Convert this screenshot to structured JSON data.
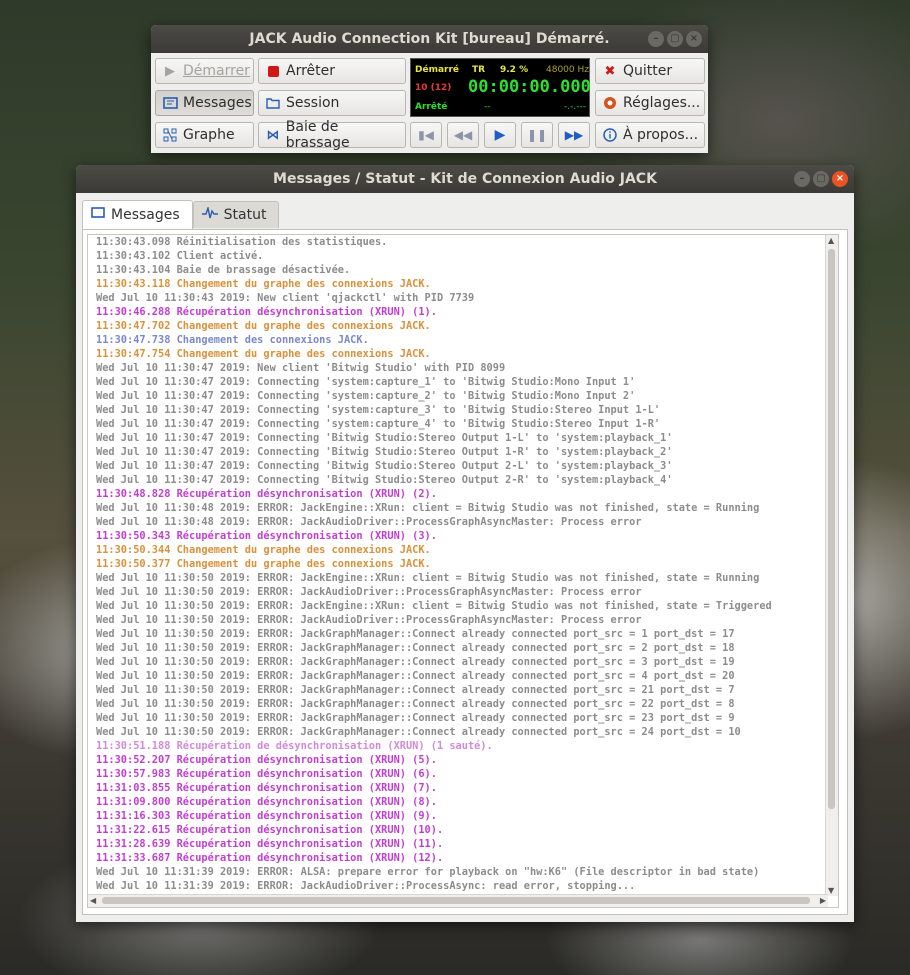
{
  "jack_window": {
    "title": "JACK Audio Connection Kit [bureau] Démarré.",
    "buttons": {
      "start": "Démarrer",
      "stop": "Arrêter",
      "quit": "Quitter",
      "messages": "Messages",
      "session": "Session",
      "settings": "Réglages...",
      "graph": "Graphe",
      "patchbay": "Baie de brassage",
      "about": "À propos..."
    },
    "display": {
      "state": "Démarré",
      "transport_mode": "TR",
      "dsp_load": "9.2 %",
      "sample_rate": "48000 Hz",
      "xruns": "10 (12)",
      "time": "00:00:00.000",
      "transport_state": "Arrêté",
      "bpm": "--",
      "bbt": "-.-.---"
    },
    "colors": {
      "display_green": "#2ee02e",
      "display_yellow": "#e6e63a",
      "display_red": "#e63a3a"
    }
  },
  "messages_window": {
    "title": "Messages / Statut - Kit de Connexion Audio JACK",
    "tabs": [
      {
        "label": "Messages",
        "icon": "monitor-icon",
        "active": true
      },
      {
        "label": "Statut",
        "icon": "waveform-icon",
        "active": false
      }
    ],
    "log_lines": [
      {
        "text": "11:30:43.098 Réinitialisation des statistiques.",
        "color": "gray"
      },
      {
        "text": "11:30:43.102 Client activé.",
        "color": "gray"
      },
      {
        "text": "11:30:43.104 Baie de brassage désactivée.",
        "color": "gray"
      },
      {
        "text": "11:30:43.118 Changement du graphe des connexions JACK.",
        "color": "orange"
      },
      {
        "text": "Wed Jul 10 11:30:43 2019: New client 'qjackctl' with PID 7739",
        "color": "gray"
      },
      {
        "text": "11:30:46.288 Récupération désynchronisation (XRUN) (1).",
        "color": "magenta"
      },
      {
        "text": "11:30:47.702 Changement du graphe des connexions JACK.",
        "color": "orange"
      },
      {
        "text": "11:30:47.738 Changement des connexions JACK.",
        "color": "blue"
      },
      {
        "text": "11:30:47.754 Changement du graphe des connexions JACK.",
        "color": "orange"
      },
      {
        "text": "Wed Jul 10 11:30:47 2019: New client 'Bitwig Studio' with PID 8099",
        "color": "gray"
      },
      {
        "text": "Wed Jul 10 11:30:47 2019: Connecting 'system:capture_1' to 'Bitwig Studio:Mono Input 1'",
        "color": "gray"
      },
      {
        "text": "Wed Jul 10 11:30:47 2019: Connecting 'system:capture_2' to 'Bitwig Studio:Mono Input 2'",
        "color": "gray"
      },
      {
        "text": "Wed Jul 10 11:30:47 2019: Connecting 'system:capture_3' to 'Bitwig Studio:Stereo Input 1-L'",
        "color": "gray"
      },
      {
        "text": "Wed Jul 10 11:30:47 2019: Connecting 'system:capture_4' to 'Bitwig Studio:Stereo Input 1-R'",
        "color": "gray"
      },
      {
        "text": "Wed Jul 10 11:30:47 2019: Connecting 'Bitwig Studio:Stereo Output 1-L' to 'system:playback_1'",
        "color": "gray"
      },
      {
        "text": "Wed Jul 10 11:30:47 2019: Connecting 'Bitwig Studio:Stereo Output 1-R' to 'system:playback_2'",
        "color": "gray"
      },
      {
        "text": "Wed Jul 10 11:30:47 2019: Connecting 'Bitwig Studio:Stereo Output 2-L' to 'system:playback_3'",
        "color": "gray"
      },
      {
        "text": "Wed Jul 10 11:30:47 2019: Connecting 'Bitwig Studio:Stereo Output 2-R' to 'system:playback_4'",
        "color": "gray"
      },
      {
        "text": "11:30:48.828 Récupération désynchronisation (XRUN) (2).",
        "color": "magenta"
      },
      {
        "text": "Wed Jul 10 11:30:48 2019: ERROR: JackEngine::XRun: client = Bitwig Studio was not finished, state = Running",
        "color": "gray"
      },
      {
        "text": "Wed Jul 10 11:30:48 2019: ERROR: JackAudioDriver::ProcessGraphAsyncMaster: Process error",
        "color": "gray"
      },
      {
        "text": "11:30:50.343 Récupération désynchronisation (XRUN) (3).",
        "color": "magenta"
      },
      {
        "text": "11:30:50.344 Changement du graphe des connexions JACK.",
        "color": "orange"
      },
      {
        "text": "11:30:50.377 Changement du graphe des connexions JACK.",
        "color": "orange"
      },
      {
        "text": "Wed Jul 10 11:30:50 2019: ERROR: JackEngine::XRun: client = Bitwig Studio was not finished, state = Running",
        "color": "gray"
      },
      {
        "text": "Wed Jul 10 11:30:50 2019: ERROR: JackAudioDriver::ProcessGraphAsyncMaster: Process error",
        "color": "gray"
      },
      {
        "text": "Wed Jul 10 11:30:50 2019: ERROR: JackEngine::XRun: client = Bitwig Studio was not finished, state = Triggered",
        "color": "gray"
      },
      {
        "text": "Wed Jul 10 11:30:50 2019: ERROR: JackAudioDriver::ProcessGraphAsyncMaster: Process error",
        "color": "gray"
      },
      {
        "text": "Wed Jul 10 11:30:50 2019: ERROR: JackGraphManager::Connect already connected port_src = 1 port_dst = 17",
        "color": "gray"
      },
      {
        "text": "Wed Jul 10 11:30:50 2019: ERROR: JackGraphManager::Connect already connected port_src = 2 port_dst = 18",
        "color": "gray"
      },
      {
        "text": "Wed Jul 10 11:30:50 2019: ERROR: JackGraphManager::Connect already connected port_src = 3 port_dst = 19",
        "color": "gray"
      },
      {
        "text": "Wed Jul 10 11:30:50 2019: ERROR: JackGraphManager::Connect already connected port_src = 4 port_dst = 20",
        "color": "gray"
      },
      {
        "text": "Wed Jul 10 11:30:50 2019: ERROR: JackGraphManager::Connect already connected port_src = 21 port_dst = 7",
        "color": "gray"
      },
      {
        "text": "Wed Jul 10 11:30:50 2019: ERROR: JackGraphManager::Connect already connected port_src = 22 port_dst = 8",
        "color": "gray"
      },
      {
        "text": "Wed Jul 10 11:30:50 2019: ERROR: JackGraphManager::Connect already connected port_src = 23 port_dst = 9",
        "color": "gray"
      },
      {
        "text": "Wed Jul 10 11:30:50 2019: ERROR: JackGraphManager::Connect already connected port_src = 24 port_dst = 10",
        "color": "gray"
      },
      {
        "text": "11:30:51.188 Récupération de désynchronisation (XRUN) (1 sauté).",
        "color": "pink"
      },
      {
        "text": "11:30:52.207 Récupération désynchronisation (XRUN) (5).",
        "color": "magenta"
      },
      {
        "text": "11:30:57.983 Récupération désynchronisation (XRUN) (6).",
        "color": "magenta"
      },
      {
        "text": "11:31:03.855 Récupération désynchronisation (XRUN) (7).",
        "color": "magenta"
      },
      {
        "text": "11:31:09.800 Récupération désynchronisation (XRUN) (8).",
        "color": "magenta"
      },
      {
        "text": "11:31:16.303 Récupération désynchronisation (XRUN) (9).",
        "color": "magenta"
      },
      {
        "text": "11:31:22.615 Récupération désynchronisation (XRUN) (10).",
        "color": "magenta"
      },
      {
        "text": "11:31:28.639 Récupération désynchronisation (XRUN) (11).",
        "color": "magenta"
      },
      {
        "text": "11:31:33.687 Récupération désynchronisation (XRUN) (12).",
        "color": "magenta"
      },
      {
        "text": "Wed Jul 10 11:31:39 2019: ERROR: ALSA: prepare error for playback on \"hw:K6\" (File descriptor in bad state)",
        "color": "gray"
      },
      {
        "text": "Wed Jul 10 11:31:39 2019: ERROR: JackAudioDriver::ProcessAsync: read error, stopping...",
        "color": "gray"
      }
    ]
  }
}
